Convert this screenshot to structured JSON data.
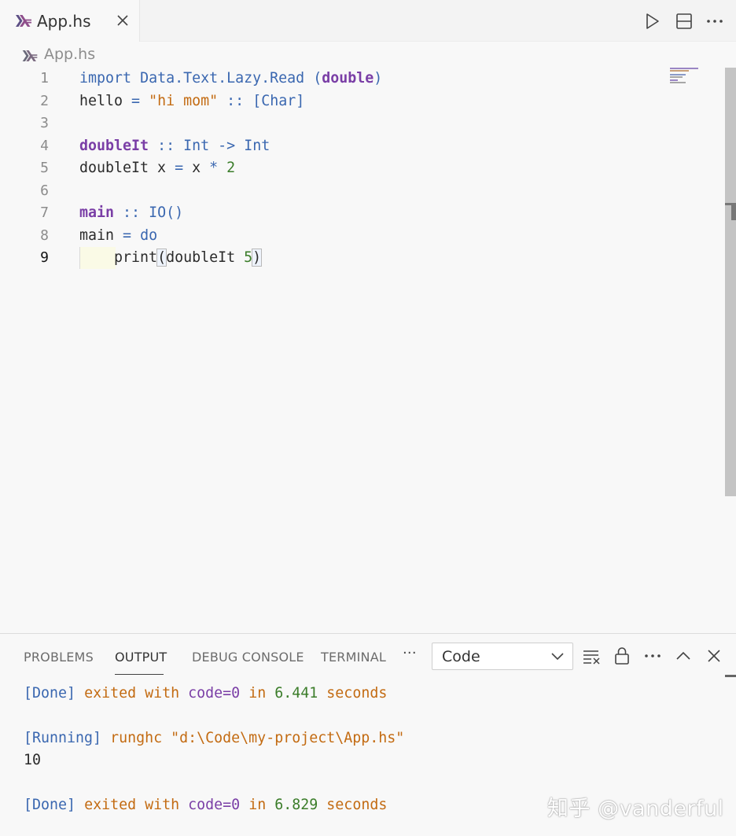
{
  "editor_tab": {
    "title": "App.hs",
    "icon": "haskell-icon",
    "close_icon": "close-icon"
  },
  "title_actions": [
    "run-icon",
    "split-editor-icon",
    "more-actions-icon"
  ],
  "breadcrumb": {
    "label": "App.hs",
    "icon": "haskell-icon"
  },
  "editor": {
    "active_line": 9,
    "lines": [
      {
        "number": "1",
        "text": "import Data.Text.Lazy.Read (double)"
      },
      {
        "number": "2",
        "text": "hello = \"hi mom\" :: [Char]"
      },
      {
        "number": "3",
        "text": ""
      },
      {
        "number": "4",
        "text": "doubleIt :: Int -> Int"
      },
      {
        "number": "5",
        "text": "doubleIt x = x * 2"
      },
      {
        "number": "6",
        "text": ""
      },
      {
        "number": "7",
        "text": "main :: IO()"
      },
      {
        "number": "8",
        "text": "main = do"
      },
      {
        "number": "9",
        "text": "    print(doubleIt 5)"
      }
    ]
  },
  "panel": {
    "tabs": [
      {
        "label": "PROBLEMS"
      },
      {
        "label": "OUTPUT",
        "active": true
      },
      {
        "label": "DEBUG CONSOLE"
      },
      {
        "label": "TERMINAL"
      }
    ],
    "more_label": "···",
    "output_channel": "Code",
    "actions": [
      "clear-output-icon",
      "lock-scroll-icon",
      "more-actions-icon",
      "maximize-panel-icon",
      "close-panel-icon"
    ],
    "output_lines": [
      "[Done] exited with code=0 in 6.441 seconds",
      "",
      "[Running] runghc \"d:\\Code\\my-project\\App.hs\"",
      "10",
      "",
      "[Done] exited with code=0 in 6.829 seconds"
    ]
  },
  "watermark": "知乎 @vanderful",
  "colors": {
    "keyword": "#7a3ea6",
    "type": "#3a67b0",
    "string": "#c36b12",
    "number": "#3b7d2a"
  }
}
